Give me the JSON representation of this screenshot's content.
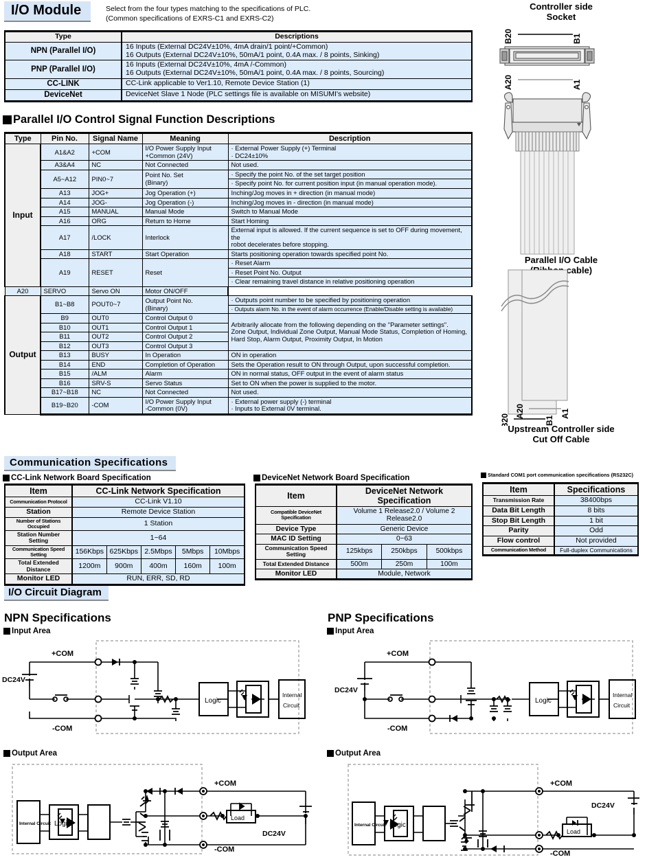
{
  "module": {
    "title": "I/O Module",
    "note_line1": "Select from the four types matching to the specifications of PLC.",
    "note_line2": "(Common specifications of EXRS-C1 and EXRS-C2)"
  },
  "type_table": {
    "headers": [
      "Type",
      "Descriptions"
    ],
    "rows": [
      {
        "type": "NPN (Parallel I/O)",
        "desc": [
          "16 Inputs (External DC24V±10%, 4mA drain/1 point/+Common)",
          "16 Outputs (External DC24V±10%, 50mA/1 point, 0.4A max. / 8 points, Sinking)"
        ]
      },
      {
        "type": "PNP (Parallel I/O)",
        "desc": [
          "16 Inputs (External DC24V±10%, 4mA /-Common)",
          "16 Outputs (External DC24V±10%, 50mA/1 point, 0.4A max. / 8 points, Sourcing)"
        ]
      },
      {
        "type": "CC-LINK",
        "desc": [
          "CC-Link applicable to Ver1.10, Remote Device Station (1)"
        ]
      },
      {
        "type": "DeviceNet",
        "desc": [
          "DeviceNet Slave 1 Node (PLC settings file is available on MISUMI's website)"
        ]
      }
    ]
  },
  "pio": {
    "heading": "Parallel I/O Control Signal Function Descriptions",
    "headers": [
      "Type",
      "Pin No.",
      "Signal Name",
      "Meaning",
      "Description"
    ],
    "input_label": "Input",
    "output_label": "Output",
    "input_rows": [
      {
        "pin": "A1&A2",
        "signal": "+COM",
        "meaning": "I/O Power Supply Input\n+Common (24V)",
        "desc": "· External Power Supply (+) Terminal\n· DC24±10%"
      },
      {
        "pin": "A3&A4",
        "signal": "NC",
        "meaning": "Not Connected",
        "desc": "Not used."
      },
      {
        "pin": "A5~A12",
        "signal": "PIN0~7",
        "meaning": "Point No. Set\n(Binary)",
        "desc_a": "· Specify the point No. of the set target position",
        "desc_b": "· Specify point No. for current position input (in manual operation mode)."
      },
      {
        "pin": "A13",
        "signal": "JOG+",
        "meaning": "Jog Operation (+)",
        "desc": "Inching/Jog moves in + direction (in manual mode)"
      },
      {
        "pin": "A14",
        "signal": "JOG-",
        "meaning": "Jog Operation (-)",
        "desc": "Inching/Jog moves in - direction (in manual mode)"
      },
      {
        "pin": "A15",
        "signal": "MANUAL",
        "meaning": "Manual Mode",
        "desc": "Switch to Manual Mode"
      },
      {
        "pin": "A16",
        "signal": "ORG",
        "meaning": "Return to Home",
        "desc": "Start Homing"
      },
      {
        "pin": "A17",
        "signal": "/LOCK",
        "meaning": "Interlock",
        "desc": "External input is allowed. If the current sequence is set to OFF during movement, the\nrobot decelerates before stopping."
      },
      {
        "pin": "A18",
        "signal": "START",
        "meaning": "Start Operation",
        "desc": "Starts positioning operation towards specified point No."
      },
      {
        "pin": "A19",
        "signal": "RESET",
        "meaning": "Reset",
        "desc_1": "· Reset Alarm",
        "desc_2": "· Reset Point No. Output",
        "desc_3": "· Clear remaining travel distance in relative positioning operation"
      },
      {
        "pin": "A20",
        "signal": "SERVO",
        "meaning": "Servo ON",
        "desc": "Motor ON/OFF"
      }
    ],
    "output_rows": [
      {
        "pin": "B1~B8",
        "signal": "POUT0~7",
        "meaning": "Output Point No.\n(Binary)",
        "desc_a": "· Outputs point number to be specified by positioning operation",
        "desc_b": "· Outputs alarm No. in the event of alarm occurrence (Enable/Disable setting is available)"
      },
      {
        "pin": "B9",
        "signal": "OUT0",
        "meaning": "Control Output 0"
      },
      {
        "pin": "B10",
        "signal": "OUT1",
        "meaning": "Control Output 1"
      },
      {
        "pin": "B11",
        "signal": "OUT2",
        "meaning": "Control Output 2"
      },
      {
        "pin": "B12",
        "signal": "OUT3",
        "meaning": "Control Output 3"
      },
      {
        "pin": "B13",
        "signal": "BUSY",
        "meaning": "In Operation",
        "desc": "ON in operation"
      },
      {
        "pin": "B14",
        "signal": "END",
        "meaning": "Completion of Operation",
        "desc": "Sets the Operation result to ON through Output, upon successful completion."
      },
      {
        "pin": "B15",
        "signal": "/ALM",
        "meaning": "Alarm",
        "desc": "ON in normal status, OFF output in the event of alarm status"
      },
      {
        "pin": "B16",
        "signal": "SRV-S",
        "meaning": "Servo Status",
        "desc": "Set to ON when the power is supplied to the motor."
      },
      {
        "pin": "B17~B18",
        "signal": "NC",
        "meaning": "Not Connected",
        "desc": "Not used."
      },
      {
        "pin": "B19~B20",
        "signal": "-COM",
        "meaning": "I/O Power Supply Input\n-Common (0V)",
        "desc": "· External power supply (-) terminal\n· Inputs to External 0V terminal."
      }
    ],
    "out_merged_desc": "Arbitrarily allocate from the following depending on the \"Parameter settings\".\nZone Output, Individual Zone Output, Manual Mode Status, Completion of Homing,\nHard Stop, Alarm Output, Proximity Output, In Motion"
  },
  "comm": {
    "title": "Communication Specifications",
    "cclink": {
      "sub": "CC-Link Network Board Specification",
      "h_item": "Item",
      "h_spec": "CC-Link Network Specification",
      "rows": [
        {
          "k": "Communication Protocol",
          "v": "CC-Link V1.10"
        },
        {
          "k": "Station",
          "v": "Remote Device Station"
        },
        {
          "k": "Number of Stations Occupied",
          "v": "1 Station"
        },
        {
          "k": "Station Number Setting",
          "v": "1~64"
        }
      ],
      "speed_label": "Communication Speed Setting",
      "speeds": [
        "156Kbps",
        "625Kbps",
        "2.5Mbps",
        "5Mbps",
        "10Mbps"
      ],
      "dist_label": "Total Extended Distance",
      "dists": [
        "1200m",
        "900m",
        "400m",
        "160m",
        "100m"
      ],
      "led_label": "Monitor LED",
      "led_value": "RUN, ERR, SD, RD"
    },
    "devicenet": {
      "sub": "DeviceNet Network Board Specification",
      "h_item": "Item",
      "h_spec": "DeviceNet Network Specification",
      "rows": [
        {
          "k": "Compatible DeviceNet Specification",
          "v": "Volume 1 Release2.0 / Volume 2 Release2.0"
        },
        {
          "k": "Device Type",
          "v": "Generic Device"
        },
        {
          "k": "MAC ID Setting",
          "v": "0~63"
        }
      ],
      "speed_label": "Communication Speed Setting",
      "speeds": [
        "125kbps",
        "250kbps",
        "500kbps"
      ],
      "dist_label": "Total Extended Distance",
      "dists": [
        "500m",
        "250m",
        "100m"
      ],
      "led_label": "Monitor LED",
      "led_value": "Module, Network"
    },
    "rs232c": {
      "sub": "Standard COM1 port communication specifications (RS232C)",
      "h_item": "Item",
      "h_spec": "Specifications",
      "rows": [
        {
          "k": "Transmission Rate",
          "v": "38400bps"
        },
        {
          "k": "Data Bit Length",
          "v": "8 bits"
        },
        {
          "k": "Stop Bit Length",
          "v": "1 bit"
        },
        {
          "k": "Parity",
          "v": "Odd"
        },
        {
          "k": "Flow control",
          "v": "Not provided"
        },
        {
          "k": "Communication Method",
          "v": "Full-duplex Communications"
        }
      ]
    }
  },
  "circuit": {
    "title": "I/O Circuit Diagram",
    "npn_spec": "NPN Specifications",
    "pnp_spec": "PNP Specifications",
    "input_area": "Input Area",
    "output_area": "Output Area",
    "labels": {
      "plus_com": "+COM",
      "minus_com": "-COM",
      "dc24v": "DC24V",
      "logic": "Logic",
      "internal_circuit_l1": "Internal",
      "internal_circuit_l2": "Circuit",
      "internal_circuit_one": "Internal Circuit",
      "load": "Load"
    }
  },
  "connector": {
    "cap_top_l1": "Controller side",
    "cap_top_l2": "Socket",
    "cap_mid_l1": "Parallel I/O Cable",
    "cap_mid_l2": "(Ribbon cable)",
    "cap_bot_l1": "Upstream Controller side",
    "cap_bot_l2": "Cut Off Cable",
    "pins": {
      "b20": "B20",
      "b1": "B1",
      "a20": "A20",
      "a1": "A1"
    }
  }
}
